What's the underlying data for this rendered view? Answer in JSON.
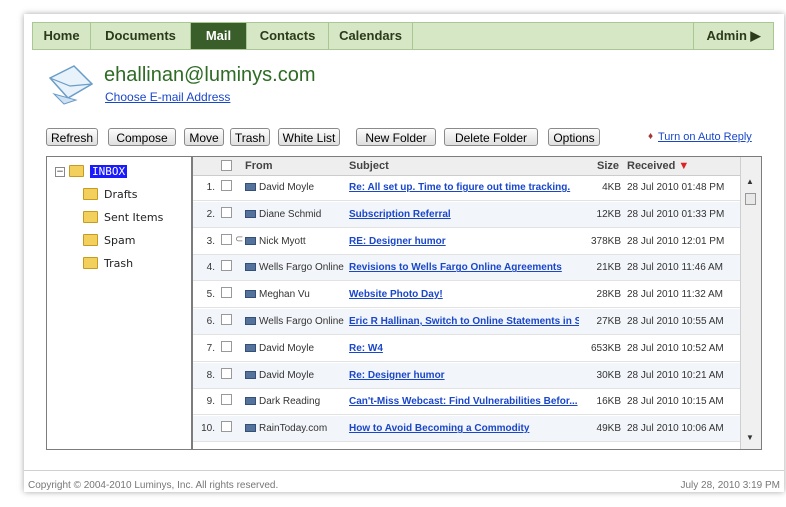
{
  "nav": {
    "tabs": [
      {
        "label": "Home"
      },
      {
        "label": "Documents"
      },
      {
        "label": "Mail"
      },
      {
        "label": "Contacts"
      },
      {
        "label": "Calendars"
      }
    ],
    "active_tab": "Mail",
    "admin_label": "Admin ▶"
  },
  "header": {
    "email": "ehallinan@luminys.com",
    "choose_link": "Choose E-mail Address"
  },
  "toolbar": {
    "refresh": "Refresh",
    "compose": "Compose",
    "move": "Move",
    "trash": "Trash",
    "white_list": "White List",
    "new_folder": "New Folder",
    "delete_folder": "Delete Folder",
    "options": "Options",
    "auto_reply": "Turn on Auto Reply"
  },
  "folders": {
    "inbox": "INBOX",
    "items": [
      {
        "label": "Drafts"
      },
      {
        "label": "Sent Items"
      },
      {
        "label": "Spam"
      },
      {
        "label": "Trash"
      }
    ]
  },
  "list": {
    "headers": {
      "from": "From",
      "subject": "Subject",
      "size": "Size",
      "received": "Received"
    },
    "rows": [
      {
        "num": "1.",
        "from": "David Moyle",
        "subject": "Re: All set up. Time to figure out time tracking.",
        "size": "4KB",
        "received": "28 Jul 2010 01:48 PM"
      },
      {
        "num": "2.",
        "from": "Diane Schmid",
        "subject": "Subscription Referral",
        "size": "12KB",
        "received": "28 Jul 2010 01:33 PM"
      },
      {
        "num": "3.",
        "from": "Nick Myott",
        "subject": "RE: Designer humor",
        "size": "378KB",
        "received": "28 Jul 2010 12:01 PM"
      },
      {
        "num": "4.",
        "from": "Wells Fargo Online",
        "subject": "Revisions to Wells Fargo Online Agreements",
        "size": "21KB",
        "received": "28 Jul 2010 11:46 AM"
      },
      {
        "num": "5.",
        "from": "Meghan Vu",
        "subject": "Website Photo Day!",
        "size": "28KB",
        "received": "28 Jul 2010 11:32 AM"
      },
      {
        "num": "6.",
        "from": "Wells Fargo Online",
        "subject": "Eric R Hallinan, Switch to Online Statements in S...",
        "size": "27KB",
        "received": "28 Jul 2010 10:55 AM"
      },
      {
        "num": "7.",
        "from": "David Moyle",
        "subject": "Re: W4",
        "size": "653KB",
        "received": "28 Jul 2010 10:52 AM"
      },
      {
        "num": "8.",
        "from": "David Moyle",
        "subject": "Re: Designer humor",
        "size": "30KB",
        "received": "28 Jul 2010 10:21 AM"
      },
      {
        "num": "9.",
        "from": "Dark Reading",
        "subject": "Can't-Miss Webcast: Find Vulnerabilities Befor...",
        "size": "16KB",
        "received": "28 Jul 2010 10:15 AM"
      },
      {
        "num": "10.",
        "from": "RainToday.com",
        "subject": "How to Avoid Becoming a Commodity",
        "size": "49KB",
        "received": "28 Jul 2010 10:06 AM"
      }
    ]
  },
  "footer": {
    "copyright": "Copyright © 2004-2010 Luminys, Inc. All rights reserved.",
    "date": "July 28, 2010 3:19 PM"
  },
  "colors": {
    "nav_bg": "#d6e7c6",
    "nav_active": "#3a5e2a",
    "email_title": "#2e6b24",
    "link": "#1a47c9"
  }
}
